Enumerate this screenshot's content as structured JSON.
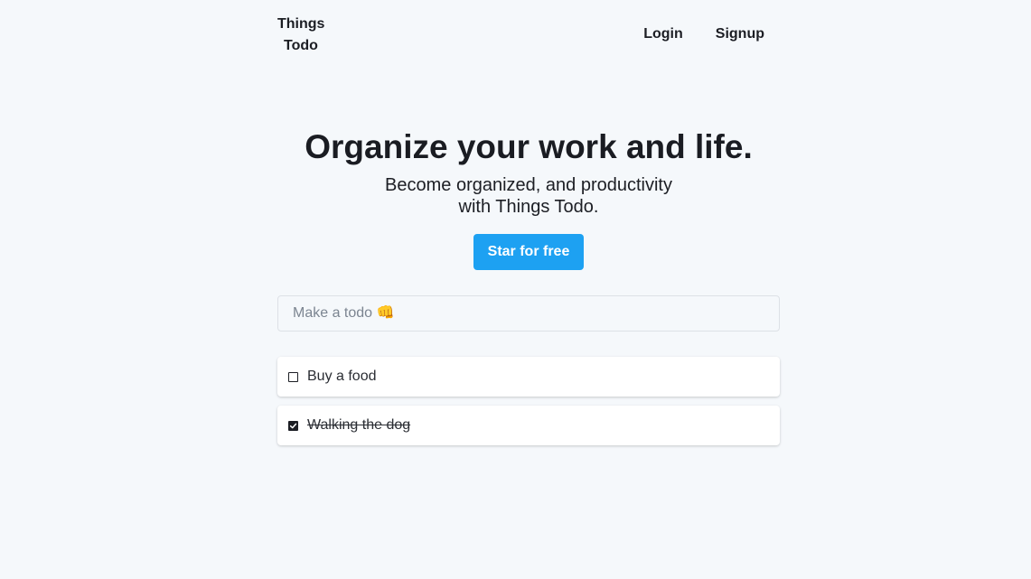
{
  "header": {
    "brand_line1": "Things",
    "brand_line2": "Todo",
    "nav": {
      "login": "Login",
      "signup": "Signup"
    }
  },
  "hero": {
    "title": "Organize your work and life.",
    "subtitle_line1": "Become organized, and productivity",
    "subtitle_line2": "with Things Todo.",
    "cta_label": "Star for free"
  },
  "todo_input": {
    "placeholder": "Make a todo 👊",
    "value": ""
  },
  "todos": [
    {
      "text": "Buy a food",
      "done": false
    },
    {
      "text": "Walking the dog",
      "done": true
    }
  ],
  "colors": {
    "background": "#f5f8fb",
    "accent": "#1da1f2",
    "text": "#1c1e24"
  }
}
